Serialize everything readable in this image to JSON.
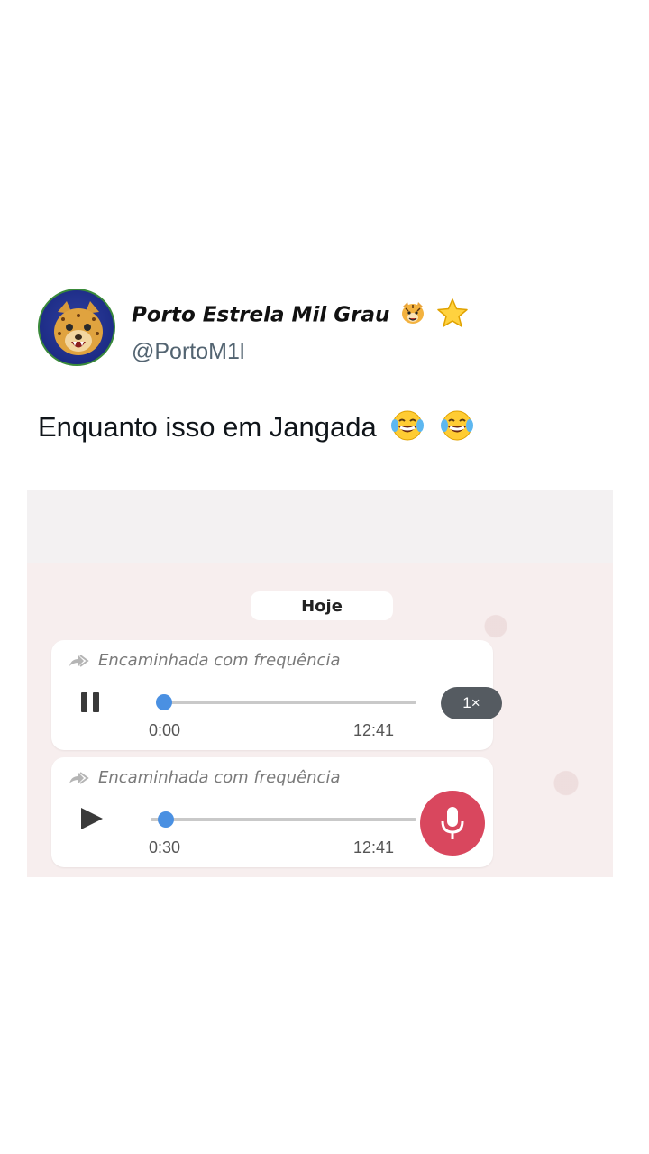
{
  "tweet": {
    "display_name": "Porto Estrela Mil Grau",
    "name_emojis": [
      "tiger-face-emoji",
      "star-emoji"
    ],
    "handle": "@PortoM1l",
    "text": "Enquanto isso em Jangada",
    "text_emojis": [
      "tears-of-joy-emoji",
      "tears-of-joy-emoji"
    ]
  },
  "media": {
    "date_label": "Hoje",
    "messages": [
      {
        "forwarded_label": "Encaminhada com frequência",
        "state": "playing",
        "control_icon": "pause-icon",
        "current_time": "0:00",
        "duration": "12:41",
        "progress": 0.0,
        "speed_label": "1×"
      },
      {
        "forwarded_label": "Encaminhada com frequência",
        "state": "paused",
        "control_icon": "play-icon",
        "current_time": "0:30",
        "duration": "12:41",
        "progress": 0.04
      }
    ],
    "mic_icon": "microphone-icon"
  },
  "colors": {
    "progress_knob": "#4a90e2",
    "mic_button": "#d9475e",
    "speed_badge": "#555b61",
    "handle_text": "#536471"
  }
}
